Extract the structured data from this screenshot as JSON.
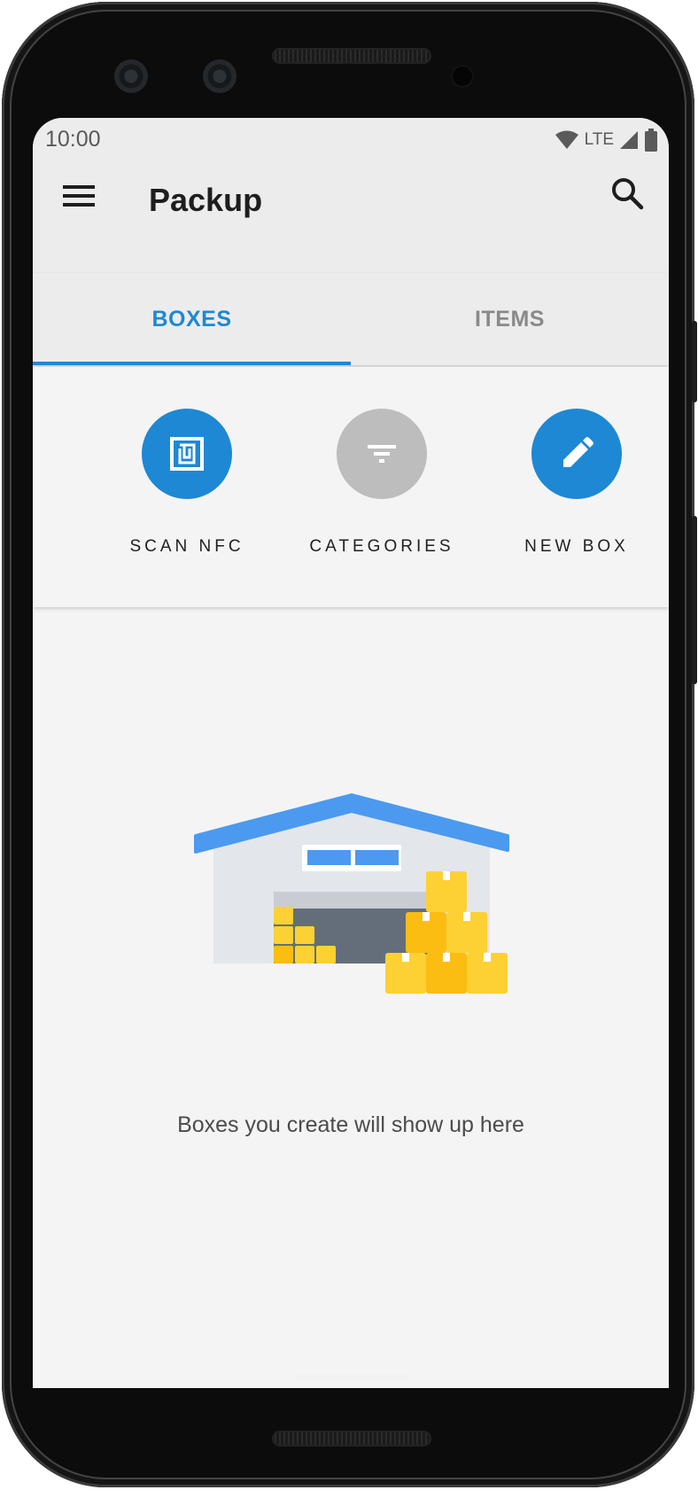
{
  "status_bar": {
    "time": "10:00",
    "network_label": "LTE",
    "icons": [
      "wifi-icon",
      "signal-icon",
      "battery-icon"
    ]
  },
  "app_bar": {
    "title": "Packup",
    "icons": [
      "menu-icon",
      "search-icon"
    ]
  },
  "tabs": [
    {
      "label": "BOXES",
      "selected": true
    },
    {
      "label": "ITEMS",
      "selected": false
    }
  ],
  "actions": [
    {
      "label": "SCAN NFC",
      "icon": "nfc-icon",
      "color": "#1e88d4"
    },
    {
      "label": "CATEGORIES",
      "icon": "filter-icon",
      "color": "#bdbdbd"
    },
    {
      "label": "NEW BOX",
      "icon": "pencil-icon",
      "color": "#1e88d4"
    }
  ],
  "empty_state": {
    "illustration": "warehouse-illustration",
    "message": "Boxes you create will show up here"
  },
  "colors": {
    "accent": "#1e88d4",
    "disabled": "#bdbdbd",
    "background": "#f4f4f4",
    "appbar": "#ececec",
    "box_yellow": "#fdd133"
  }
}
